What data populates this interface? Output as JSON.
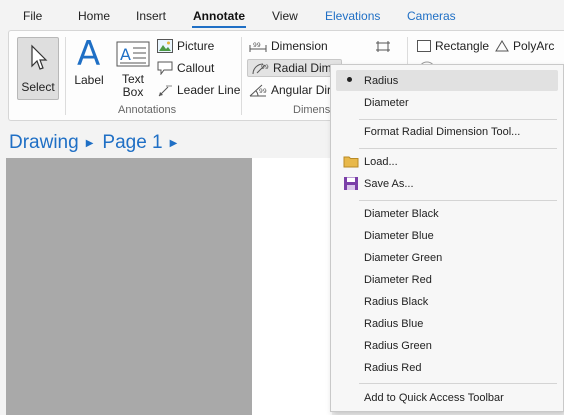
{
  "tabs": [
    {
      "label": "File"
    },
    {
      "label": "Home"
    },
    {
      "label": "Insert"
    },
    {
      "label": "Annotate"
    },
    {
      "label": "View"
    },
    {
      "label": "Elevations"
    },
    {
      "label": "Cameras"
    }
  ],
  "ribbon": {
    "select_label": "Select",
    "label_label": "Label",
    "textbox_line1": "Text",
    "textbox_line2": "Box",
    "picture_label": "Picture",
    "callout_label": "Callout",
    "leader_line_label": "Leader Line",
    "annotations_group": "Annotations",
    "dimension_label": "Dimension",
    "radial_dimension_label": "Radial Dime",
    "angular_dimension_label": "Angular Dir",
    "dimensions_group": "Dimens",
    "rectangle_label": "Rectangle",
    "polyarc_label": "PolyArc"
  },
  "breadcrumb": {
    "drawing": "Drawing",
    "page": "Page 1"
  },
  "menu": {
    "radius": "Radius",
    "diameter": "Diameter",
    "format": "Format Radial Dimension Tool...",
    "load": "Load...",
    "save_as": "Save As...",
    "presets": [
      "Diameter Black",
      "Diameter Blue",
      "Diameter Green",
      "Diameter Red",
      "Radius Black",
      "Radius Blue",
      "Radius Green",
      "Radius Red"
    ],
    "add_qat": "Add to Quick Access Toolbar"
  },
  "colors": {
    "accent": "#1f6fc5",
    "canvas_grey": "#a9a9a9"
  }
}
